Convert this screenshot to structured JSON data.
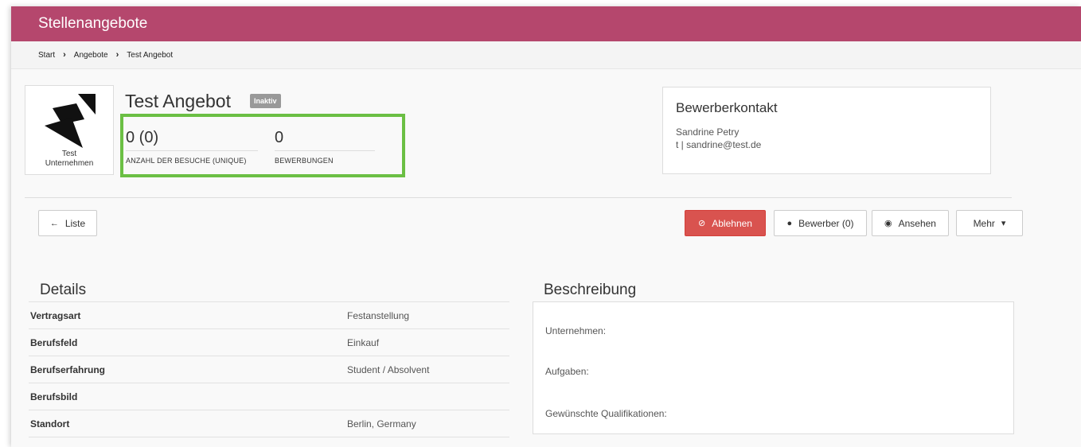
{
  "header": {
    "title": "Stellenangebote"
  },
  "breadcrumb": [
    {
      "label": "Start"
    },
    {
      "label": "Angebote"
    },
    {
      "label": "Test Angebot"
    }
  ],
  "company": {
    "name_line1": "Test",
    "name_line2": "Unternehmen"
  },
  "job": {
    "title": "Test Angebot",
    "status_badge": "Inaktiv"
  },
  "stats": {
    "visits_value": "0 (0)",
    "visits_label": "ANZAHL DER BESUCHE (UNIQUE)",
    "applications_value": "0",
    "applications_label": "BEWERBUNGEN"
  },
  "contact": {
    "title": "Bewerberkontakt",
    "name": "Sandrine Petry",
    "info": "t | sandrine@test.de"
  },
  "actions": {
    "back_label": "Liste",
    "reject_label": "Ablehnen",
    "applicants_label": "Bewerber (0)",
    "view_label": "Ansehen",
    "more_label": "Mehr"
  },
  "details": {
    "title": "Details",
    "rows": [
      {
        "key": "Vertragsart",
        "value": "Festanstellung"
      },
      {
        "key": "Berufsfeld",
        "value": "Einkauf"
      },
      {
        "key": "Berufserfahrung",
        "value": "Student / Absolvent"
      },
      {
        "key": "Berufsbild",
        "value": ""
      },
      {
        "key": "Standort",
        "value": "Berlin, Germany"
      }
    ]
  },
  "description": {
    "title": "Beschreibung",
    "items": [
      "Unternehmen:",
      "Aufgaben:",
      "Gewünschte Qualifikationen:"
    ]
  },
  "colors": {
    "brand": "#b5476d",
    "danger": "#d9534f",
    "highlight": "#6bbf44",
    "badge": "#999999"
  }
}
